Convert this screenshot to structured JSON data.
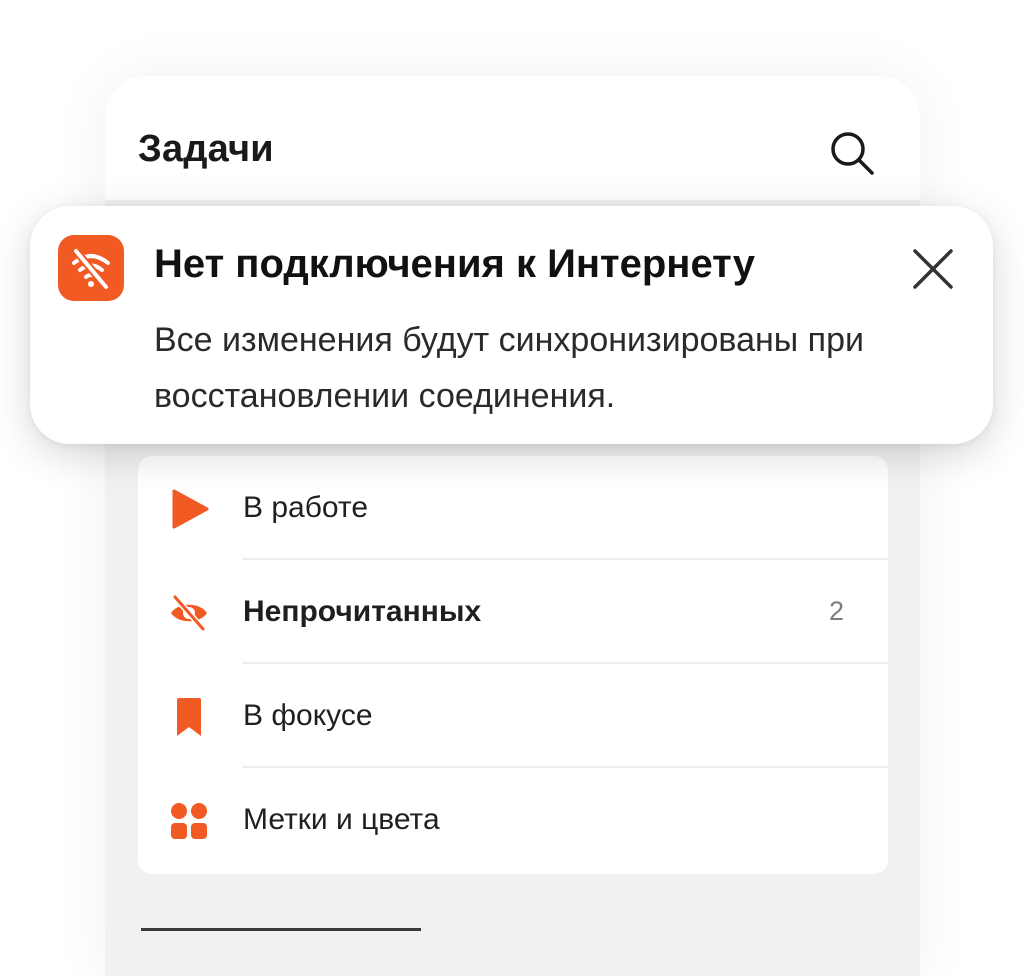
{
  "header": {
    "title": "Задачи",
    "search_icon": "search-icon"
  },
  "toast": {
    "icon": "wifi-off-icon",
    "title": "Нет подключения к Интернету",
    "message": "Все изменения будут синхронизированы при восстановлении соединения.",
    "close_icon": "close-icon"
  },
  "lists": [
    {
      "label": "В работе",
      "icon": "play-icon",
      "bold": false,
      "count": ""
    },
    {
      "label": "Непрочитанных",
      "icon": "eye-off-icon",
      "bold": true,
      "count": "2"
    },
    {
      "label": "В фокусе",
      "icon": "bookmark-icon",
      "bold": false,
      "count": ""
    },
    {
      "label": "Метки и цвета",
      "icon": "tags-grid-icon",
      "bold": false,
      "count": ""
    }
  ],
  "colors": {
    "accent": "#f15a22",
    "background": "#f1f1f3",
    "text": "#1a1a1a",
    "muted": "#7d7d7d"
  }
}
